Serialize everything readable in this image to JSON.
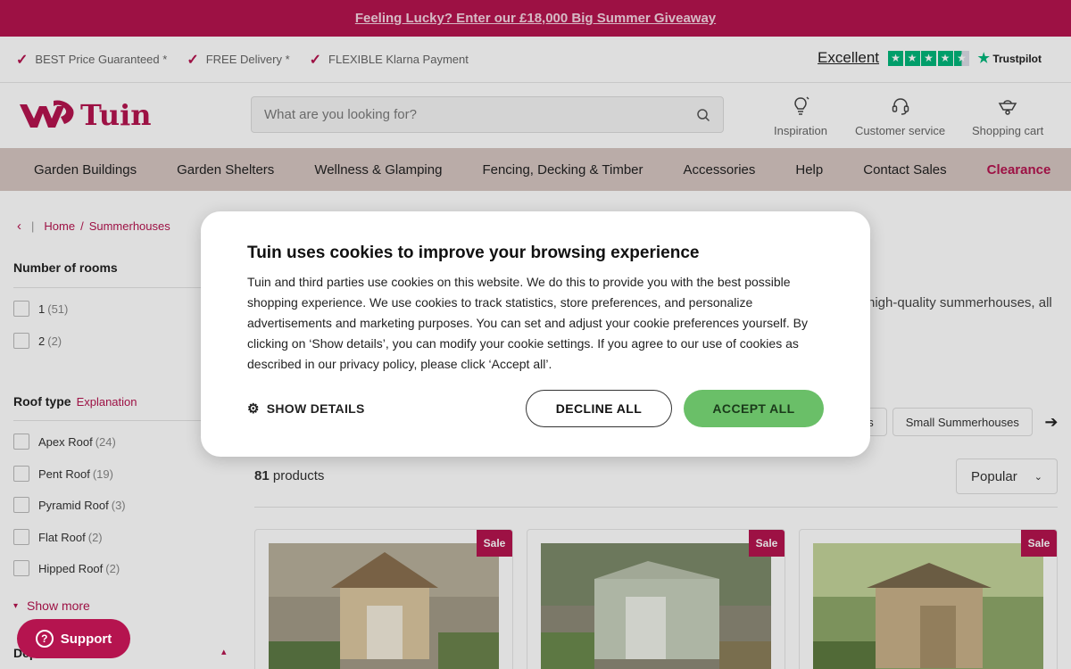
{
  "promo": {
    "text": "Feeling Lucky? Enter our £18,000 Big Summer Giveaway"
  },
  "usp": [
    {
      "label": "BEST Price Guaranteed *"
    },
    {
      "label": "FREE Delivery *"
    },
    {
      "label": "FLEXIBLE Klarna Payment"
    }
  ],
  "trustpilot": {
    "rating_label": "Excellent",
    "brand": "Trustpilot",
    "stars": 4.5,
    "color": "#00b67a"
  },
  "header": {
    "logo": "Tuin",
    "search_placeholder": "What are you looking for?",
    "links": [
      {
        "label": "Inspiration",
        "icon": "lightbulb-icon"
      },
      {
        "label": "Customer service",
        "icon": "headset-icon"
      },
      {
        "label": "Shopping cart",
        "icon": "wheelbarrow-icon"
      }
    ]
  },
  "nav": [
    "Garden Buildings",
    "Garden Shelters",
    "Wellness & Glamping",
    "Fencing, Decking & Timber",
    "Accessories",
    "Help",
    "Contact Sales",
    "Clearance"
  ],
  "breadcrumb": {
    "back": "‹",
    "sep": "|",
    "home": "Home",
    "current": "Summerhouses"
  },
  "filters": {
    "rooms": {
      "title": "Number of rooms",
      "options": [
        {
          "label": "1",
          "count": "(51)"
        },
        {
          "label": "2",
          "count": "(2)"
        }
      ]
    },
    "roof": {
      "title": "Roof type",
      "explanation": "Explanation",
      "options": [
        {
          "label": "Apex Roof",
          "count": "(24)"
        },
        {
          "label": "Pent Roof",
          "count": "(19)"
        },
        {
          "label": "Pyramid Roof",
          "count": "(3)"
        },
        {
          "label": "Flat Roof",
          "count": "(2)"
        },
        {
          "label": "Hipped Roof",
          "count": "(2)"
        }
      ],
      "show_more": "Show more"
    },
    "next_title": "Dep"
  },
  "intro_text": "high-quality summerhouses, all",
  "chips": [
    "es",
    "Small Summerhouses"
  ],
  "products": {
    "count": "81",
    "count_label": "products",
    "sort": "Popular",
    "badge": "Sale"
  },
  "support": {
    "label": "Support"
  },
  "cookie": {
    "title": "Tuin uses cookies to improve your browsing experience",
    "body": "Tuin and third parties use cookies on this website. We do this to provide you with the best possible shopping experience. We use cookies to track statistics, store preferences, and personalize advertisements and marketing purposes. You can set and adjust your cookie preferences yourself. By clicking on ‘Show details’, you can modify your cookie settings. If you agree to our use of cookies as described in our privacy policy, please click ‘Accept all’.",
    "show_details": "SHOW DETAILS",
    "decline": "DECLINE ALL",
    "accept": "ACCEPT ALL"
  },
  "colors": {
    "brand": "#b5144f",
    "nav_bg": "#d6c6c2",
    "accept": "#6abf68"
  }
}
